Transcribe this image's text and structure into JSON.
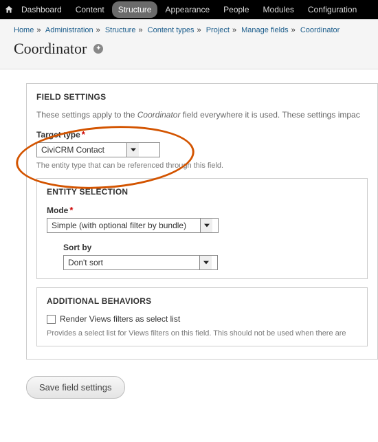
{
  "adminbar": {
    "items": [
      {
        "label": "Dashboard"
      },
      {
        "label": "Content"
      },
      {
        "label": "Structure"
      },
      {
        "label": "Appearance"
      },
      {
        "label": "People"
      },
      {
        "label": "Modules"
      },
      {
        "label": "Configuration"
      }
    ]
  },
  "breadcrumb": {
    "items": [
      "Home",
      "Administration",
      "Structure",
      "Content types",
      "Project",
      "Manage fields",
      "Coordinator"
    ]
  },
  "page": {
    "title": "Coordinator"
  },
  "fieldset": {
    "title": "FIELD SETTINGS",
    "intro_pre": "These settings apply to the ",
    "intro_em": "Coordinator",
    "intro_post": " field everywhere it is used. These settings impac",
    "target_type": {
      "label": "Target type",
      "value": "CiviCRM Contact",
      "desc": "The entity type that can be referenced through this field."
    },
    "entity_selection": {
      "title": "ENTITY SELECTION",
      "mode_label": "Mode",
      "mode_value": "Simple (with optional filter by bundle)",
      "sort_label": "Sort by",
      "sort_value": "Don't sort"
    },
    "additional": {
      "title": "ADDITIONAL BEHAVIORS",
      "checkbox_label": "Render Views filters as select list",
      "checkbox_desc": "Provides a select list for Views filters on this field. This should not be used when there are"
    }
  },
  "buttons": {
    "save": "Save field settings"
  }
}
